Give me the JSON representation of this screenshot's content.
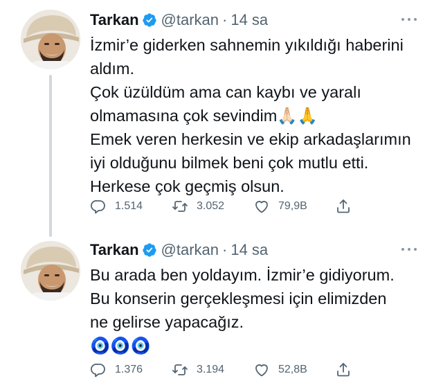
{
  "tweets": [
    {
      "author": {
        "name": "Tarkan",
        "handle": "@tarkan",
        "separator": "·",
        "time": "14 sa"
      },
      "lines": [
        "İzmir’e giderken sahnemin yıkıldığı haberini",
        "aldım.",
        "Çok üzüldüm ama can kaybı ve yaralı",
        "olmamasına çok sevindim🙏🏻🙏",
        "Emek veren herkesin ve ekip arkadaşlarımın",
        "iyi olduğunu bilmek beni çok mutlu etti.",
        "Herkese çok geçmiş olsun."
      ],
      "stats": {
        "replies": "1.514",
        "retweets": "3.052",
        "likes": "79,9B"
      }
    },
    {
      "author": {
        "name": "Tarkan",
        "handle": "@tarkan",
        "separator": "·",
        "time": "14 sa"
      },
      "lines": [
        "Bu arada ben yoldayım. İzmir’e gidiyorum.",
        "Bu konserin gerçekleşmesi için elimizden",
        "ne gelirse yapacağız.",
        "🧿🧿🧿"
      ],
      "stats": {
        "replies": "1.376",
        "retweets": "3.194",
        "likes": "52,8B"
      }
    }
  ],
  "icons": {
    "verified": "verified-badge-icon",
    "more": "more-dots-icon",
    "reply": "reply-icon",
    "retweet": "retweet-icon",
    "like": "heart-icon",
    "share": "share-icon"
  },
  "colors": {
    "text": "#0f1419",
    "secondary": "#536471",
    "verified": "#1d9bf0",
    "thread_line": "#cfd9de"
  }
}
